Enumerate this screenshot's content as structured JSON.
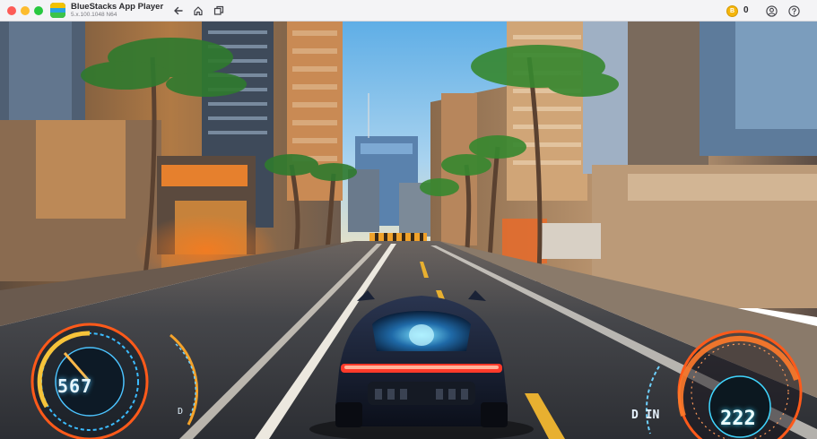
{
  "window": {
    "title": "BlueStacks App Player",
    "version": "5.x.100.1048 N64"
  },
  "toolbar": {
    "back_icon": "arrow-left-icon",
    "home_icon": "home-icon",
    "tabs_icon": "multi-window-icon"
  },
  "top_right": {
    "coin_icon": "coin-icon",
    "coin_count": "0",
    "account_icon": "user-icon",
    "help_icon": "help-icon"
  },
  "game": {
    "hud_left": {
      "speed_value": "567",
      "gear": "D"
    },
    "hud_right": {
      "speed_value": "222",
      "gear_indicator": "D IN"
    }
  },
  "colors": {
    "hud_cyan": "#4cc4ff",
    "hud_orange": "#ff6a1a",
    "sky": "#8ec6ee",
    "road": "#3a3e44"
  }
}
